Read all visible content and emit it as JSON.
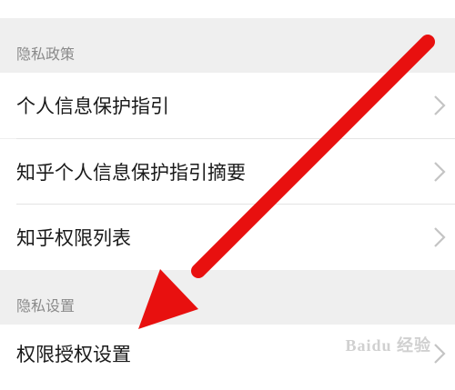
{
  "sections": [
    {
      "header": "隐私政策",
      "items": [
        {
          "label": "个人信息保护指引"
        },
        {
          "label": "知乎个人信息保护指引摘要"
        },
        {
          "label": "知乎权限列表"
        }
      ]
    },
    {
      "header": "隐私设置",
      "items": [
        {
          "label": "权限授权设置"
        }
      ]
    }
  ],
  "overlay": {
    "arrow_color": "#e8100f",
    "chevron_icon": "chevron-right-icon",
    "watermark": "Baidu 经验"
  }
}
